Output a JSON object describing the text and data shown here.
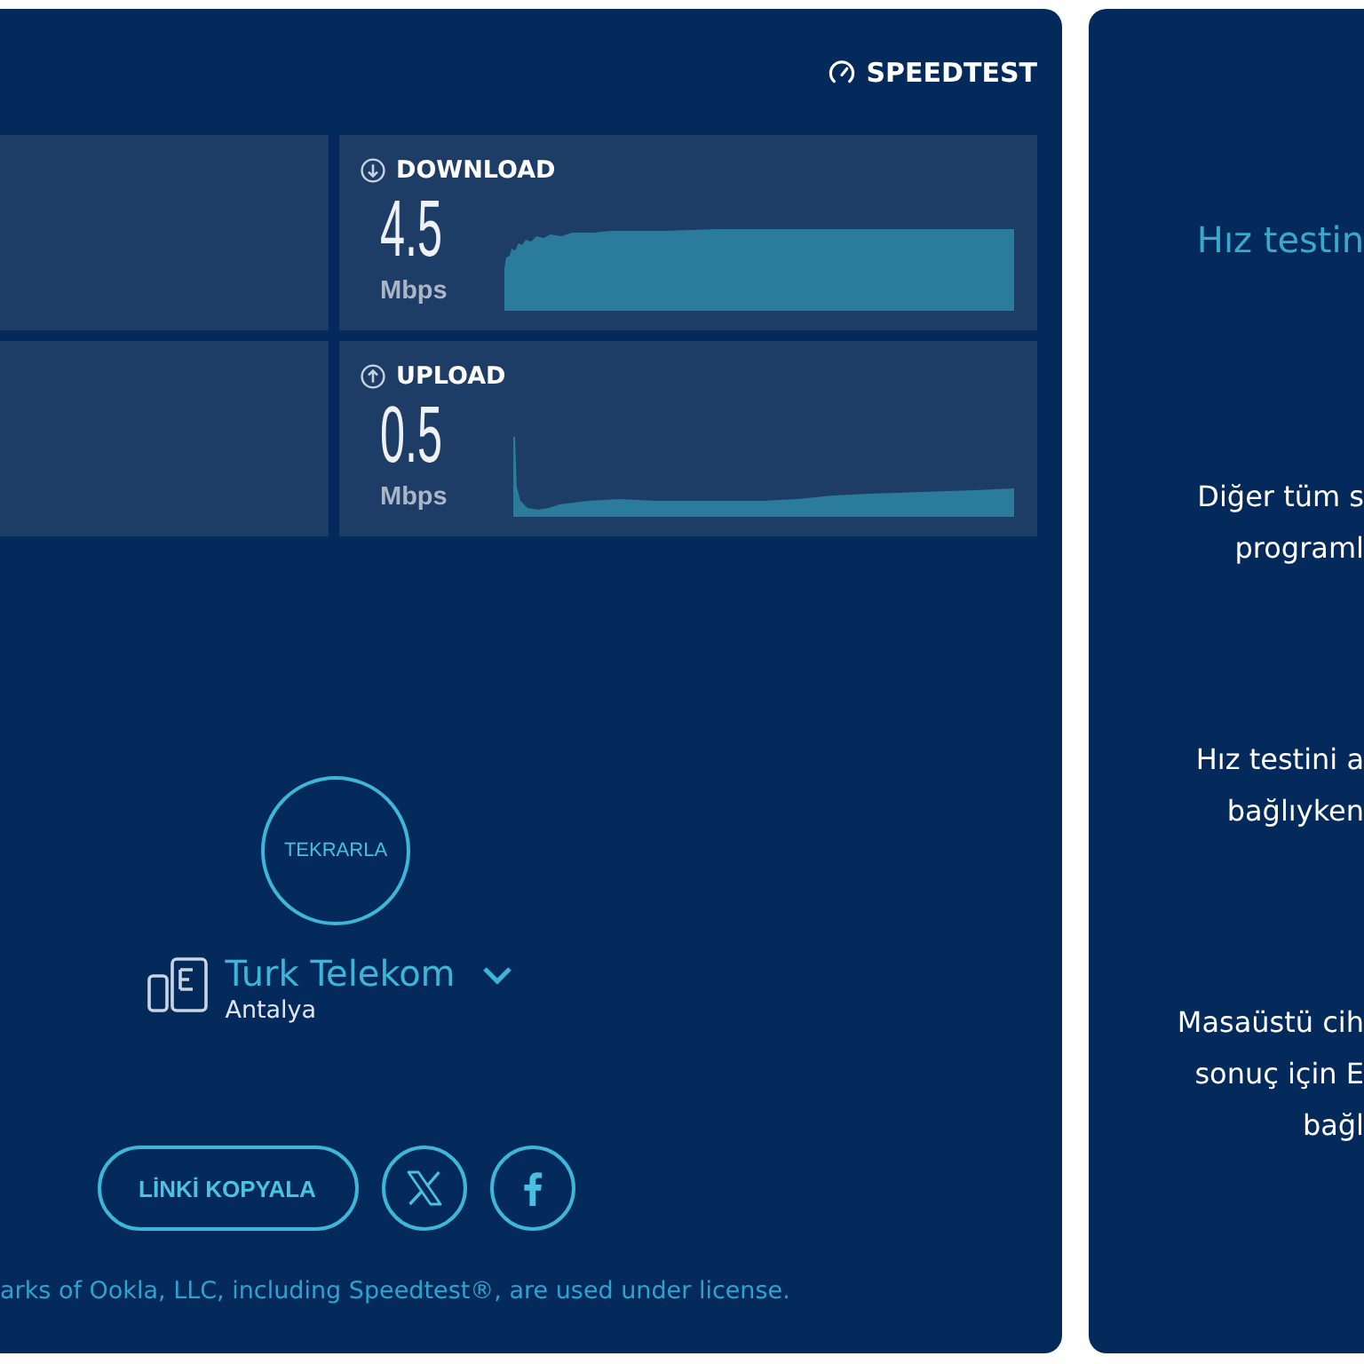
{
  "branding": {
    "logo_text": "SPEEDTEST"
  },
  "results": [
    {
      "kind": "download",
      "label": "DOWNLOAD",
      "value": "4.5",
      "unit": "Mbps"
    },
    {
      "kind": "upload",
      "label": "UPLOAD",
      "value": "0.5",
      "unit": "Mbps"
    }
  ],
  "repeat_button": {
    "label": "TEKRARLA"
  },
  "server": {
    "provider": "Turk Telekom",
    "location": "Antalya"
  },
  "share": {
    "copy_link_label": "LİNKİ KOPYALA",
    "networks": [
      {
        "kind": "x"
      },
      {
        "kind": "facebook"
      }
    ]
  },
  "footer": {
    "text": "arks of Ookla, LLC, including Speedtest®, are used under license."
  },
  "side_panel": {
    "title": "Hız testin",
    "paragraphs": [
      {
        "lines": [
          "Diğer tüm s",
          "programl"
        ]
      },
      {
        "lines": [
          "Hız testini a",
          "bağlıyken"
        ]
      },
      {
        "lines": [
          "Masaüstü cih",
          "sonuç için E",
          "bağl"
        ]
      }
    ]
  }
}
